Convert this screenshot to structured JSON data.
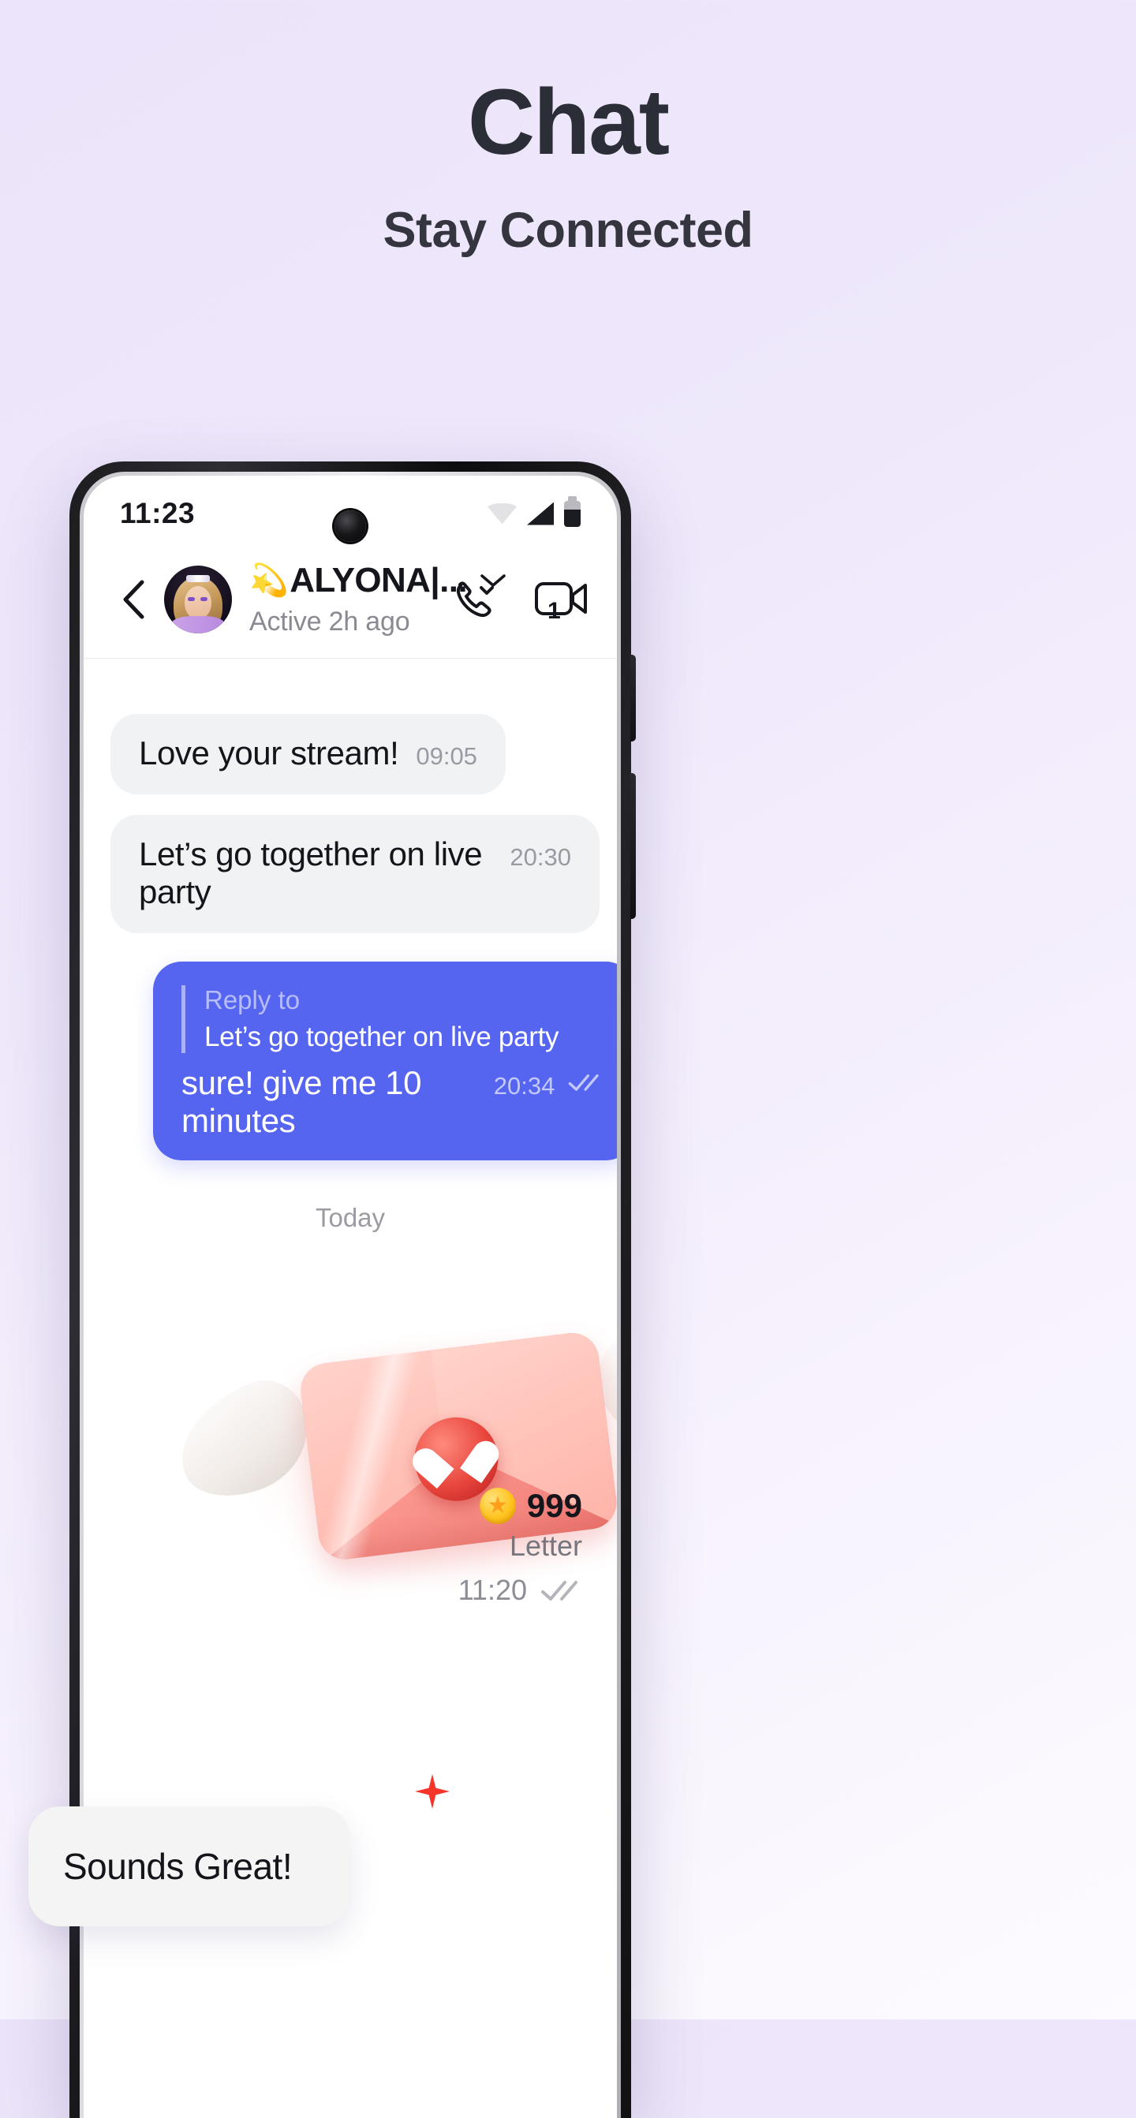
{
  "promo": {
    "title": "Chat",
    "subtitle": "Stay Connected"
  },
  "colors": {
    "accent_blue": "#5665f0",
    "bubble_in": "#f1f2f4",
    "background_top": "#ece4fa",
    "coin_gold": "#ffc421",
    "spark_red": "#f5342a"
  },
  "phone": {
    "statusbar": {
      "time": "11:23",
      "icons": [
        "wifi-icon",
        "signal-icon",
        "battery-icon"
      ],
      "camera": "front-camera-punch-hole"
    },
    "chat_header": {
      "back_icon": "chevron-left-icon",
      "avatar": "contact-avatar",
      "name": "ALYONA|...",
      "name_emoji": "💫",
      "dropdown_icon": "chevron-down-icon",
      "status": "Active 2h ago",
      "call_icon": "phone-call-icon",
      "video_icon": "video-camera-icon",
      "video_badge": "1"
    },
    "messages": [
      {
        "id": "msg-1",
        "direction": "incoming",
        "text": "Love your stream!",
        "time": "09:05"
      },
      {
        "id": "msg-2",
        "direction": "incoming",
        "text": "Let’s go together on live party",
        "time": "20:30"
      },
      {
        "id": "msg-3",
        "direction": "outgoing",
        "reply_label": "Reply to",
        "reply_quote": "Let’s go together on live party",
        "text": "sure! give me 10 minutes",
        "time": "20:34",
        "read_status": "read-double-check-icon"
      }
    ],
    "day_divider": "Today",
    "gift": {
      "illustration": "winged-heart-envelope-icon",
      "coin_icon": "star-coin-icon",
      "amount": "999",
      "label": "Letter",
      "time": "11:20",
      "read_status": "read-double-check-icon"
    }
  },
  "callout": {
    "text": "Sounds Great!"
  }
}
